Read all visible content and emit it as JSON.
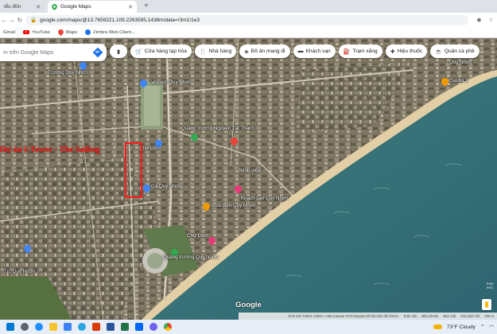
{
  "browser": {
    "tabs": [
      {
        "label": "iểu đồn",
        "active": false
      },
      {
        "label": "Google Maps",
        "active": true
      }
    ],
    "url": "google.com/maps/@13.7659221,109.2263595,1438m/data=!3m1!1e3",
    "bookmarks": [
      "Gmail",
      "YouTube",
      "Maps",
      "Zimbra Web Client..."
    ]
  },
  "map": {
    "search_placeholder": "m trên Google Maps",
    "chips": [
      {
        "icon": "gas-can-icon",
        "label": ""
      },
      {
        "icon": "shopping-cart-icon",
        "label": "Cửa hàng tạp hóa"
      },
      {
        "icon": "restaurant-icon",
        "label": "Nhà hàng"
      },
      {
        "icon": "takeout-icon",
        "label": "Đồ ăn mang đi"
      },
      {
        "icon": "bed-icon",
        "label": "Khách sạn"
      },
      {
        "icon": "gas-station-icon",
        "label": "Trạm xăng"
      },
      {
        "icon": "pharmacy-icon",
        "label": "Hiệu thuốc"
      },
      {
        "icon": "coffee-icon",
        "label": "Quán cà phê"
      }
    ],
    "overlay_title": "Dự án I-Tower - The Sailing",
    "places": [
      {
        "name": "Quy Nhơn",
        "pin": "orange"
      },
      {
        "name": "Sai bà 1",
        "pin": "orange"
      },
      {
        "name": "Vincom Quy Nhơn",
        "pin": "blue"
      },
      {
        "name": "Chợ Lớn",
        "pin": "blue"
      },
      {
        "name": "Quảng trường Nguyễn Tất Thành",
        "pin": "green"
      },
      {
        "name": "Ga Quy Nhơn",
        "pin": "blue"
      },
      {
        "name": "Bưu điện Quy Nhơn",
        "pin": "orange"
      },
      {
        "name": "Bệnh viện",
        "pin": "red"
      },
      {
        "name": "Quảng trường Quy Nhơn",
        "pin": "green"
      },
      {
        "name": "Chợ Đầm",
        "pin": "pink"
      },
      {
        "name": "Tp. Quy Nhơn",
        "pin": "blue"
      },
      {
        "name": "Khách sạn Quy Nhơn",
        "pin": "pink"
      },
      {
        "name": "Trường Quy Nhơn",
        "pin": "blue"
      }
    ],
    "google_label": "Google",
    "attribution": [
      "Hình ảnh ©2021 CNES / Airbus,Maxar Technologies,Dữ liệu bản đồ ©2021",
      "Toàn cầu",
      "Điều khoản",
      "Bảo mật",
      "Gửi phản hồi",
      "200 m"
    ],
    "lang": [
      "ENG",
      "INTL"
    ]
  },
  "taskbar": {
    "weather": "73°F Cloudy",
    "icons": [
      "windows-start-icon",
      "search-icon",
      "edge-icon",
      "file-explorer-icon",
      "store-icon",
      "telegram-icon",
      "office-icon",
      "word-icon",
      "excel-icon",
      "zalo-icon",
      "viber-icon",
      "chrome-icon"
    ]
  }
}
